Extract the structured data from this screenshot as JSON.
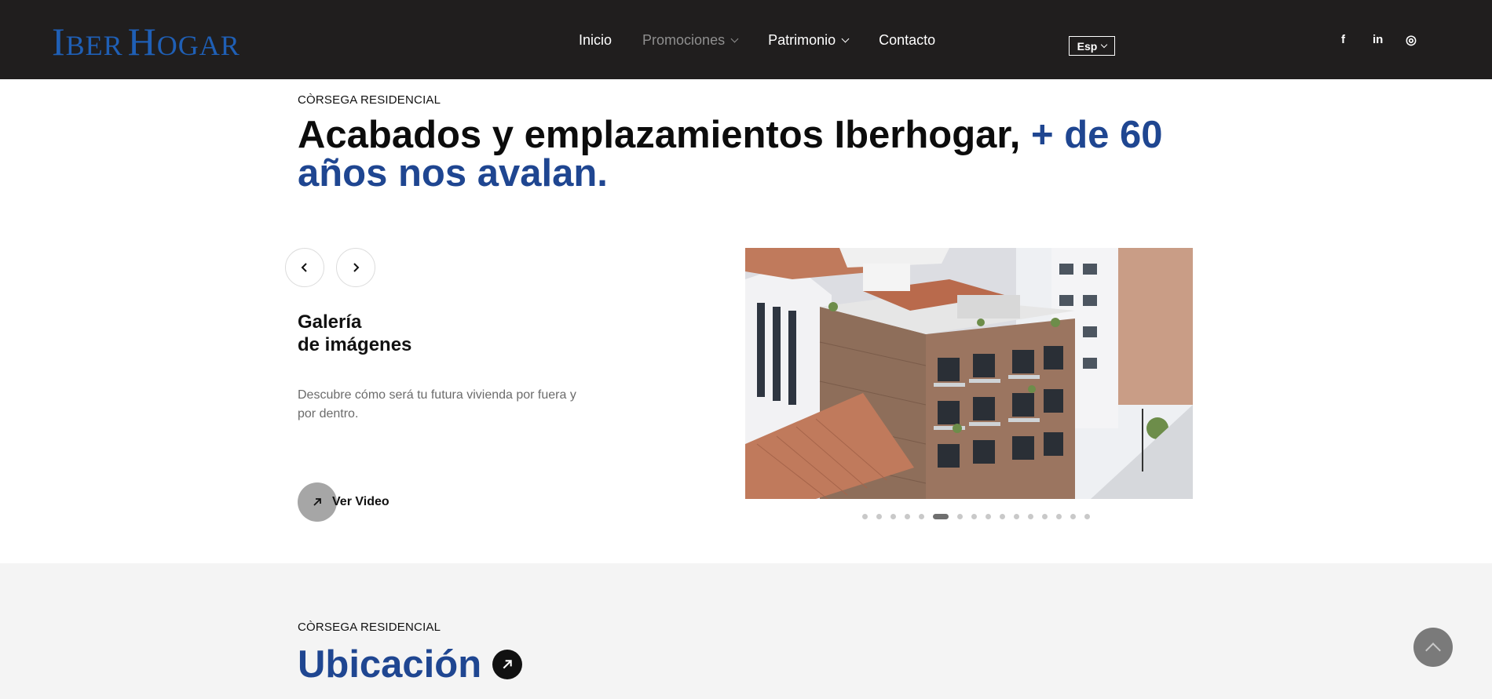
{
  "header": {
    "logo_first": "I",
    "logo_mid": "BER",
    "logo_second": "H",
    "logo_end": "OGAR",
    "nav": [
      {
        "label": "Inicio"
      },
      {
        "label": "Promociones"
      },
      {
        "label": "Patrimonio"
      },
      {
        "label": "Contacto"
      }
    ],
    "language": "Esp",
    "social": {
      "facebook": "f",
      "linkedin": "in",
      "instagram": "◎"
    }
  },
  "gallery": {
    "eyebrow": "CÒRSEGA RESIDENCIAL",
    "headline_main": "Acabados y emplazamientos Iberhogar, ",
    "headline_accent": "+ de 60 años nos avalan.",
    "title_line1": "Galería",
    "title_line2": "de imágenes",
    "description": "Descubre cómo será tu futura vivienda por fuera y por dentro.",
    "video_label": "Ver Video",
    "slides_total": 16,
    "active_slide": 6,
    "prev_icon": "‹",
    "next_icon": "›"
  },
  "location": {
    "eyebrow": "CÒRSEGA RESIDENCIAL",
    "title": "Ubicación"
  },
  "colors": {
    "header_bg": "#201e1e",
    "accent_blue": "#1f4691",
    "logo_blue": "#1f5fb5",
    "section_bg": "#f4f4f4"
  }
}
